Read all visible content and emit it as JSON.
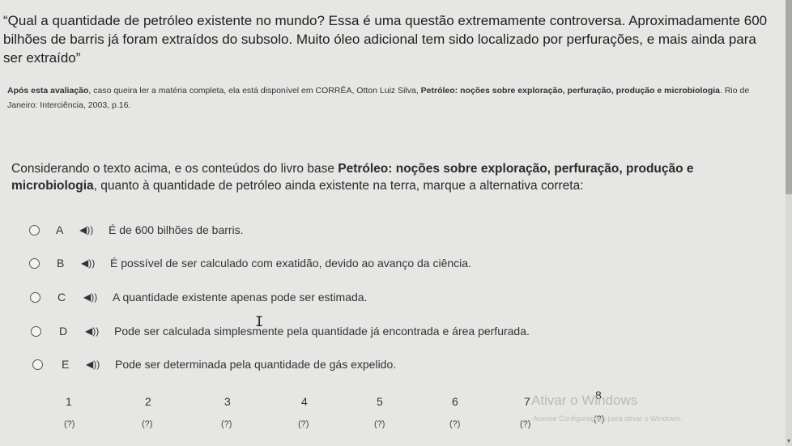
{
  "quote": "“Qual a quantidade de petróleo existente no mundo? Essa é uma questão extremamente controversa. Aproximadamente 600 bilhões de barris já foram extraídos do subsolo. Muito óleo adicional tem sido localizado por perfurações, e mais ainda para ser extraído”",
  "citation": {
    "lead": "Após esta avaliação",
    "text1": ", caso queira ler a matéria completa, ela está disponível em CORRÊA, Otton Luiz Silva, ",
    "title": "Petróleo: noções sobre exploração, perfuração, produção e microbiologia",
    "text2": ". Rio de Janeiro: Interciência, 2003, p.16."
  },
  "question": {
    "text1": "Considerando o texto acima, e os conteúdos do livro base ",
    "book": "Petróleo: noções sobre exploração, perfuração, produção e microbiologia",
    "text2": ", quanto à quantidade de petróleo ainda existente na terra, marque a alternativa correta:"
  },
  "alternatives": [
    {
      "letter": "A",
      "text": "É de 600 bilhões de barris."
    },
    {
      "letter": "B",
      "text": "É possível de ser calculado com exatidão, devido ao avanço da ciência."
    },
    {
      "letter": "C",
      "text": "A quantidade existente apenas pode ser estimada."
    },
    {
      "letter": "D",
      "text": "Pode ser calculada simplesmente pela quantidade já encontrada e área perfurada."
    },
    {
      "letter": "E",
      "text": "Pode ser determinada pela quantidade de gás expelido."
    }
  ],
  "speaker_glyph": "◀))",
  "navigation": {
    "numbers": [
      "1",
      "2",
      "3",
      "4",
      "5",
      "6",
      "7",
      "8"
    ],
    "statuses": [
      "(?)",
      "(?)",
      "(?)",
      "(?)",
      "(?)",
      "(?)",
      "(?)",
      "(?)"
    ]
  },
  "watermark": {
    "title": "Ativar o Windows",
    "subtitle": "Acesse Configurações para ativar o Windows."
  }
}
